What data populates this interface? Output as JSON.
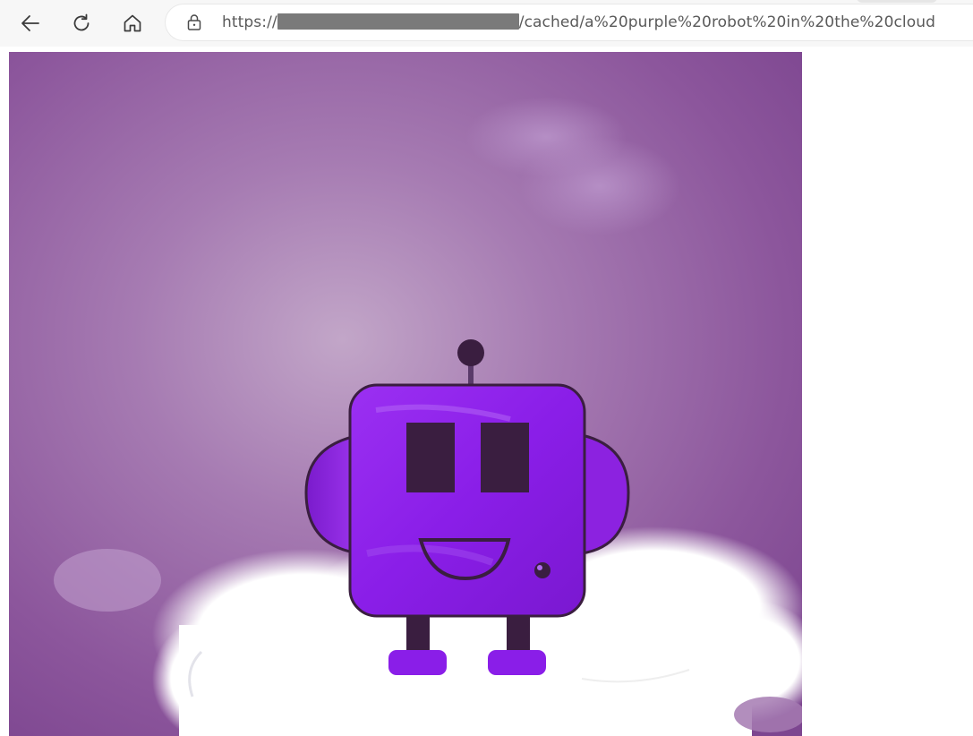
{
  "browser": {
    "url_prefix": "https://",
    "url_suffix": "/cached/a%20purple%20robot%20in%20the%20cloud",
    "back_icon": "back-arrow-icon",
    "refresh_icon": "refresh-icon",
    "home_icon": "home-icon",
    "lock_icon": "lock-icon"
  },
  "page": {
    "image_subject": "purple-robot-on-cloud",
    "colors": {
      "background_purple": "#8a4f9c",
      "robot_body": "#8d1fe6",
      "cloud_white": "#ffffff"
    }
  }
}
